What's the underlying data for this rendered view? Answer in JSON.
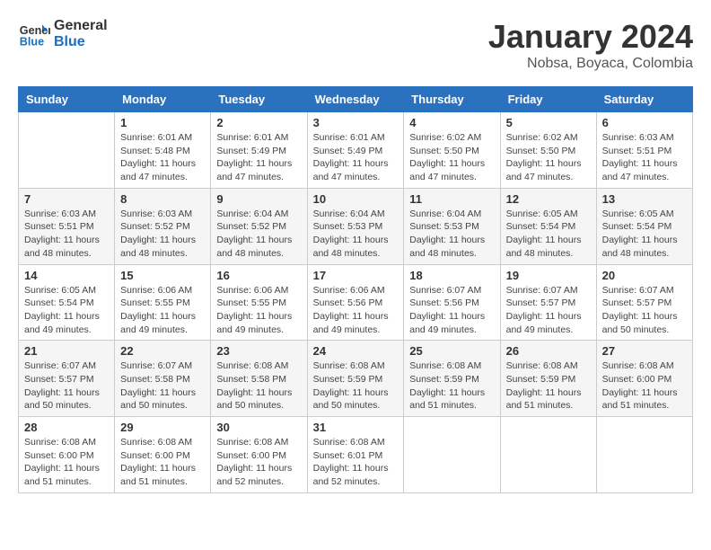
{
  "header": {
    "logo_line1": "General",
    "logo_line2": "Blue",
    "main_title": "January 2024",
    "subtitle": "Nobsa, Boyaca, Colombia"
  },
  "days_of_week": [
    "Sunday",
    "Monday",
    "Tuesday",
    "Wednesday",
    "Thursday",
    "Friday",
    "Saturday"
  ],
  "weeks": [
    [
      {
        "day": "",
        "info": ""
      },
      {
        "day": "1",
        "info": "Sunrise: 6:01 AM\nSunset: 5:48 PM\nDaylight: 11 hours and 47 minutes."
      },
      {
        "day": "2",
        "info": "Sunrise: 6:01 AM\nSunset: 5:49 PM\nDaylight: 11 hours and 47 minutes."
      },
      {
        "day": "3",
        "info": "Sunrise: 6:01 AM\nSunset: 5:49 PM\nDaylight: 11 hours and 47 minutes."
      },
      {
        "day": "4",
        "info": "Sunrise: 6:02 AM\nSunset: 5:50 PM\nDaylight: 11 hours and 47 minutes."
      },
      {
        "day": "5",
        "info": "Sunrise: 6:02 AM\nSunset: 5:50 PM\nDaylight: 11 hours and 47 minutes."
      },
      {
        "day": "6",
        "info": "Sunrise: 6:03 AM\nSunset: 5:51 PM\nDaylight: 11 hours and 47 minutes."
      }
    ],
    [
      {
        "day": "7",
        "info": "Sunrise: 6:03 AM\nSunset: 5:51 PM\nDaylight: 11 hours and 48 minutes."
      },
      {
        "day": "8",
        "info": "Sunrise: 6:03 AM\nSunset: 5:52 PM\nDaylight: 11 hours and 48 minutes."
      },
      {
        "day": "9",
        "info": "Sunrise: 6:04 AM\nSunset: 5:52 PM\nDaylight: 11 hours and 48 minutes."
      },
      {
        "day": "10",
        "info": "Sunrise: 6:04 AM\nSunset: 5:53 PM\nDaylight: 11 hours and 48 minutes."
      },
      {
        "day": "11",
        "info": "Sunrise: 6:04 AM\nSunset: 5:53 PM\nDaylight: 11 hours and 48 minutes."
      },
      {
        "day": "12",
        "info": "Sunrise: 6:05 AM\nSunset: 5:54 PM\nDaylight: 11 hours and 48 minutes."
      },
      {
        "day": "13",
        "info": "Sunrise: 6:05 AM\nSunset: 5:54 PM\nDaylight: 11 hours and 48 minutes."
      }
    ],
    [
      {
        "day": "14",
        "info": "Sunrise: 6:05 AM\nSunset: 5:54 PM\nDaylight: 11 hours and 49 minutes."
      },
      {
        "day": "15",
        "info": "Sunrise: 6:06 AM\nSunset: 5:55 PM\nDaylight: 11 hours and 49 minutes."
      },
      {
        "day": "16",
        "info": "Sunrise: 6:06 AM\nSunset: 5:55 PM\nDaylight: 11 hours and 49 minutes."
      },
      {
        "day": "17",
        "info": "Sunrise: 6:06 AM\nSunset: 5:56 PM\nDaylight: 11 hours and 49 minutes."
      },
      {
        "day": "18",
        "info": "Sunrise: 6:07 AM\nSunset: 5:56 PM\nDaylight: 11 hours and 49 minutes."
      },
      {
        "day": "19",
        "info": "Sunrise: 6:07 AM\nSunset: 5:57 PM\nDaylight: 11 hours and 49 minutes."
      },
      {
        "day": "20",
        "info": "Sunrise: 6:07 AM\nSunset: 5:57 PM\nDaylight: 11 hours and 50 minutes."
      }
    ],
    [
      {
        "day": "21",
        "info": "Sunrise: 6:07 AM\nSunset: 5:57 PM\nDaylight: 11 hours and 50 minutes."
      },
      {
        "day": "22",
        "info": "Sunrise: 6:07 AM\nSunset: 5:58 PM\nDaylight: 11 hours and 50 minutes."
      },
      {
        "day": "23",
        "info": "Sunrise: 6:08 AM\nSunset: 5:58 PM\nDaylight: 11 hours and 50 minutes."
      },
      {
        "day": "24",
        "info": "Sunrise: 6:08 AM\nSunset: 5:59 PM\nDaylight: 11 hours and 50 minutes."
      },
      {
        "day": "25",
        "info": "Sunrise: 6:08 AM\nSunset: 5:59 PM\nDaylight: 11 hours and 51 minutes."
      },
      {
        "day": "26",
        "info": "Sunrise: 6:08 AM\nSunset: 5:59 PM\nDaylight: 11 hours and 51 minutes."
      },
      {
        "day": "27",
        "info": "Sunrise: 6:08 AM\nSunset: 6:00 PM\nDaylight: 11 hours and 51 minutes."
      }
    ],
    [
      {
        "day": "28",
        "info": "Sunrise: 6:08 AM\nSunset: 6:00 PM\nDaylight: 11 hours and 51 minutes."
      },
      {
        "day": "29",
        "info": "Sunrise: 6:08 AM\nSunset: 6:00 PM\nDaylight: 11 hours and 51 minutes."
      },
      {
        "day": "30",
        "info": "Sunrise: 6:08 AM\nSunset: 6:00 PM\nDaylight: 11 hours and 52 minutes."
      },
      {
        "day": "31",
        "info": "Sunrise: 6:08 AM\nSunset: 6:01 PM\nDaylight: 11 hours and 52 minutes."
      },
      {
        "day": "",
        "info": ""
      },
      {
        "day": "",
        "info": ""
      },
      {
        "day": "",
        "info": ""
      }
    ]
  ]
}
